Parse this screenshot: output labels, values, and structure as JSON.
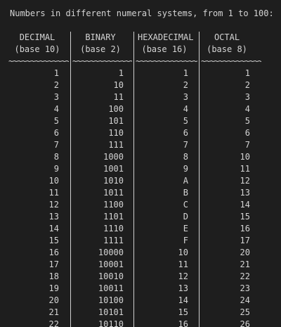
{
  "title": "Numbers in different numeral systems, from 1 to 100:",
  "headers": [
    {
      "name": "DECIMAL",
      "base": "(base 10)"
    },
    {
      "name": "BINARY",
      "base": "(base 2)"
    },
    {
      "name": "HEXADECIMAL",
      "base": "(base 16)"
    },
    {
      "name": "OCTAL",
      "base": "(base 8)"
    }
  ],
  "rule": "~~~~~~~~~~~~~~~~~~~~~~~~~~~~~~",
  "rows": [
    [
      "1",
      "1",
      "1",
      "1"
    ],
    [
      "2",
      "10",
      "2",
      "2"
    ],
    [
      "3",
      "11",
      "3",
      "3"
    ],
    [
      "4",
      "100",
      "4",
      "4"
    ],
    [
      "5",
      "101",
      "5",
      "5"
    ],
    [
      "6",
      "110",
      "6",
      "6"
    ],
    [
      "7",
      "111",
      "7",
      "7"
    ],
    [
      "8",
      "1000",
      "8",
      "10"
    ],
    [
      "9",
      "1001",
      "9",
      "11"
    ],
    [
      "10",
      "1010",
      "A",
      "12"
    ],
    [
      "11",
      "1011",
      "B",
      "13"
    ],
    [
      "12",
      "1100",
      "C",
      "14"
    ],
    [
      "13",
      "1101",
      "D",
      "15"
    ],
    [
      "14",
      "1110",
      "E",
      "16"
    ],
    [
      "15",
      "1111",
      "F",
      "17"
    ],
    [
      "16",
      "10000",
      "10",
      "20"
    ],
    [
      "17",
      "10001",
      "11",
      "21"
    ],
    [
      "18",
      "10010",
      "12",
      "22"
    ],
    [
      "19",
      "10011",
      "13",
      "23"
    ],
    [
      "20",
      "10100",
      "14",
      "24"
    ],
    [
      "21",
      "10101",
      "15",
      "25"
    ],
    [
      "22",
      "10110",
      "16",
      "26"
    ]
  ]
}
